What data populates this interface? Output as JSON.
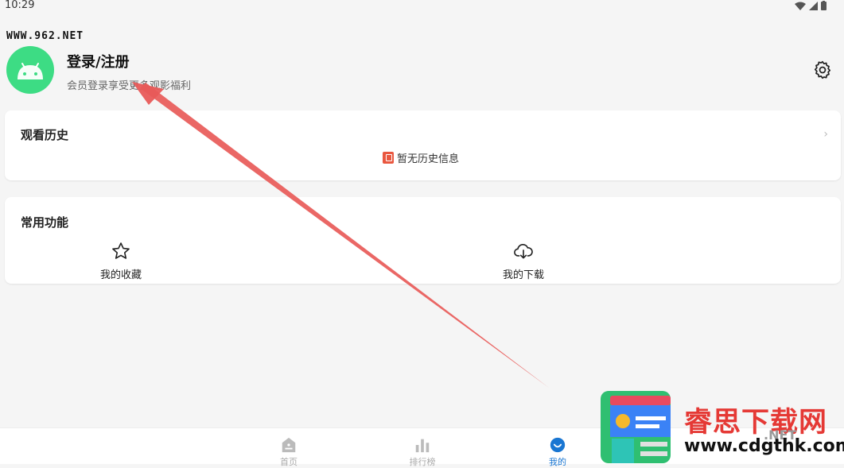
{
  "status": {
    "time": "10:29"
  },
  "watermark": {
    "top_text": "WWW.962.NET",
    "brand": "睿思下载网",
    "url": "www.cdgthk.com",
    "net": ".NET"
  },
  "profile": {
    "title": "登录/注册",
    "subtitle": "会员登录享受更多观影福利"
  },
  "history": {
    "title": "观看历史",
    "empty": "暂无历史信息"
  },
  "functions": {
    "title": "常用功能",
    "items": [
      {
        "label": "我的收藏"
      },
      {
        "label": "我的下载"
      }
    ]
  },
  "tabs": [
    {
      "label": "首页"
    },
    {
      "label": "排行榜"
    },
    {
      "label": "我的"
    }
  ],
  "colors": {
    "accent": "#1976d2",
    "avatar": "#3ddc84",
    "arrow": "#e85a58",
    "brand_red": "#e53935"
  }
}
